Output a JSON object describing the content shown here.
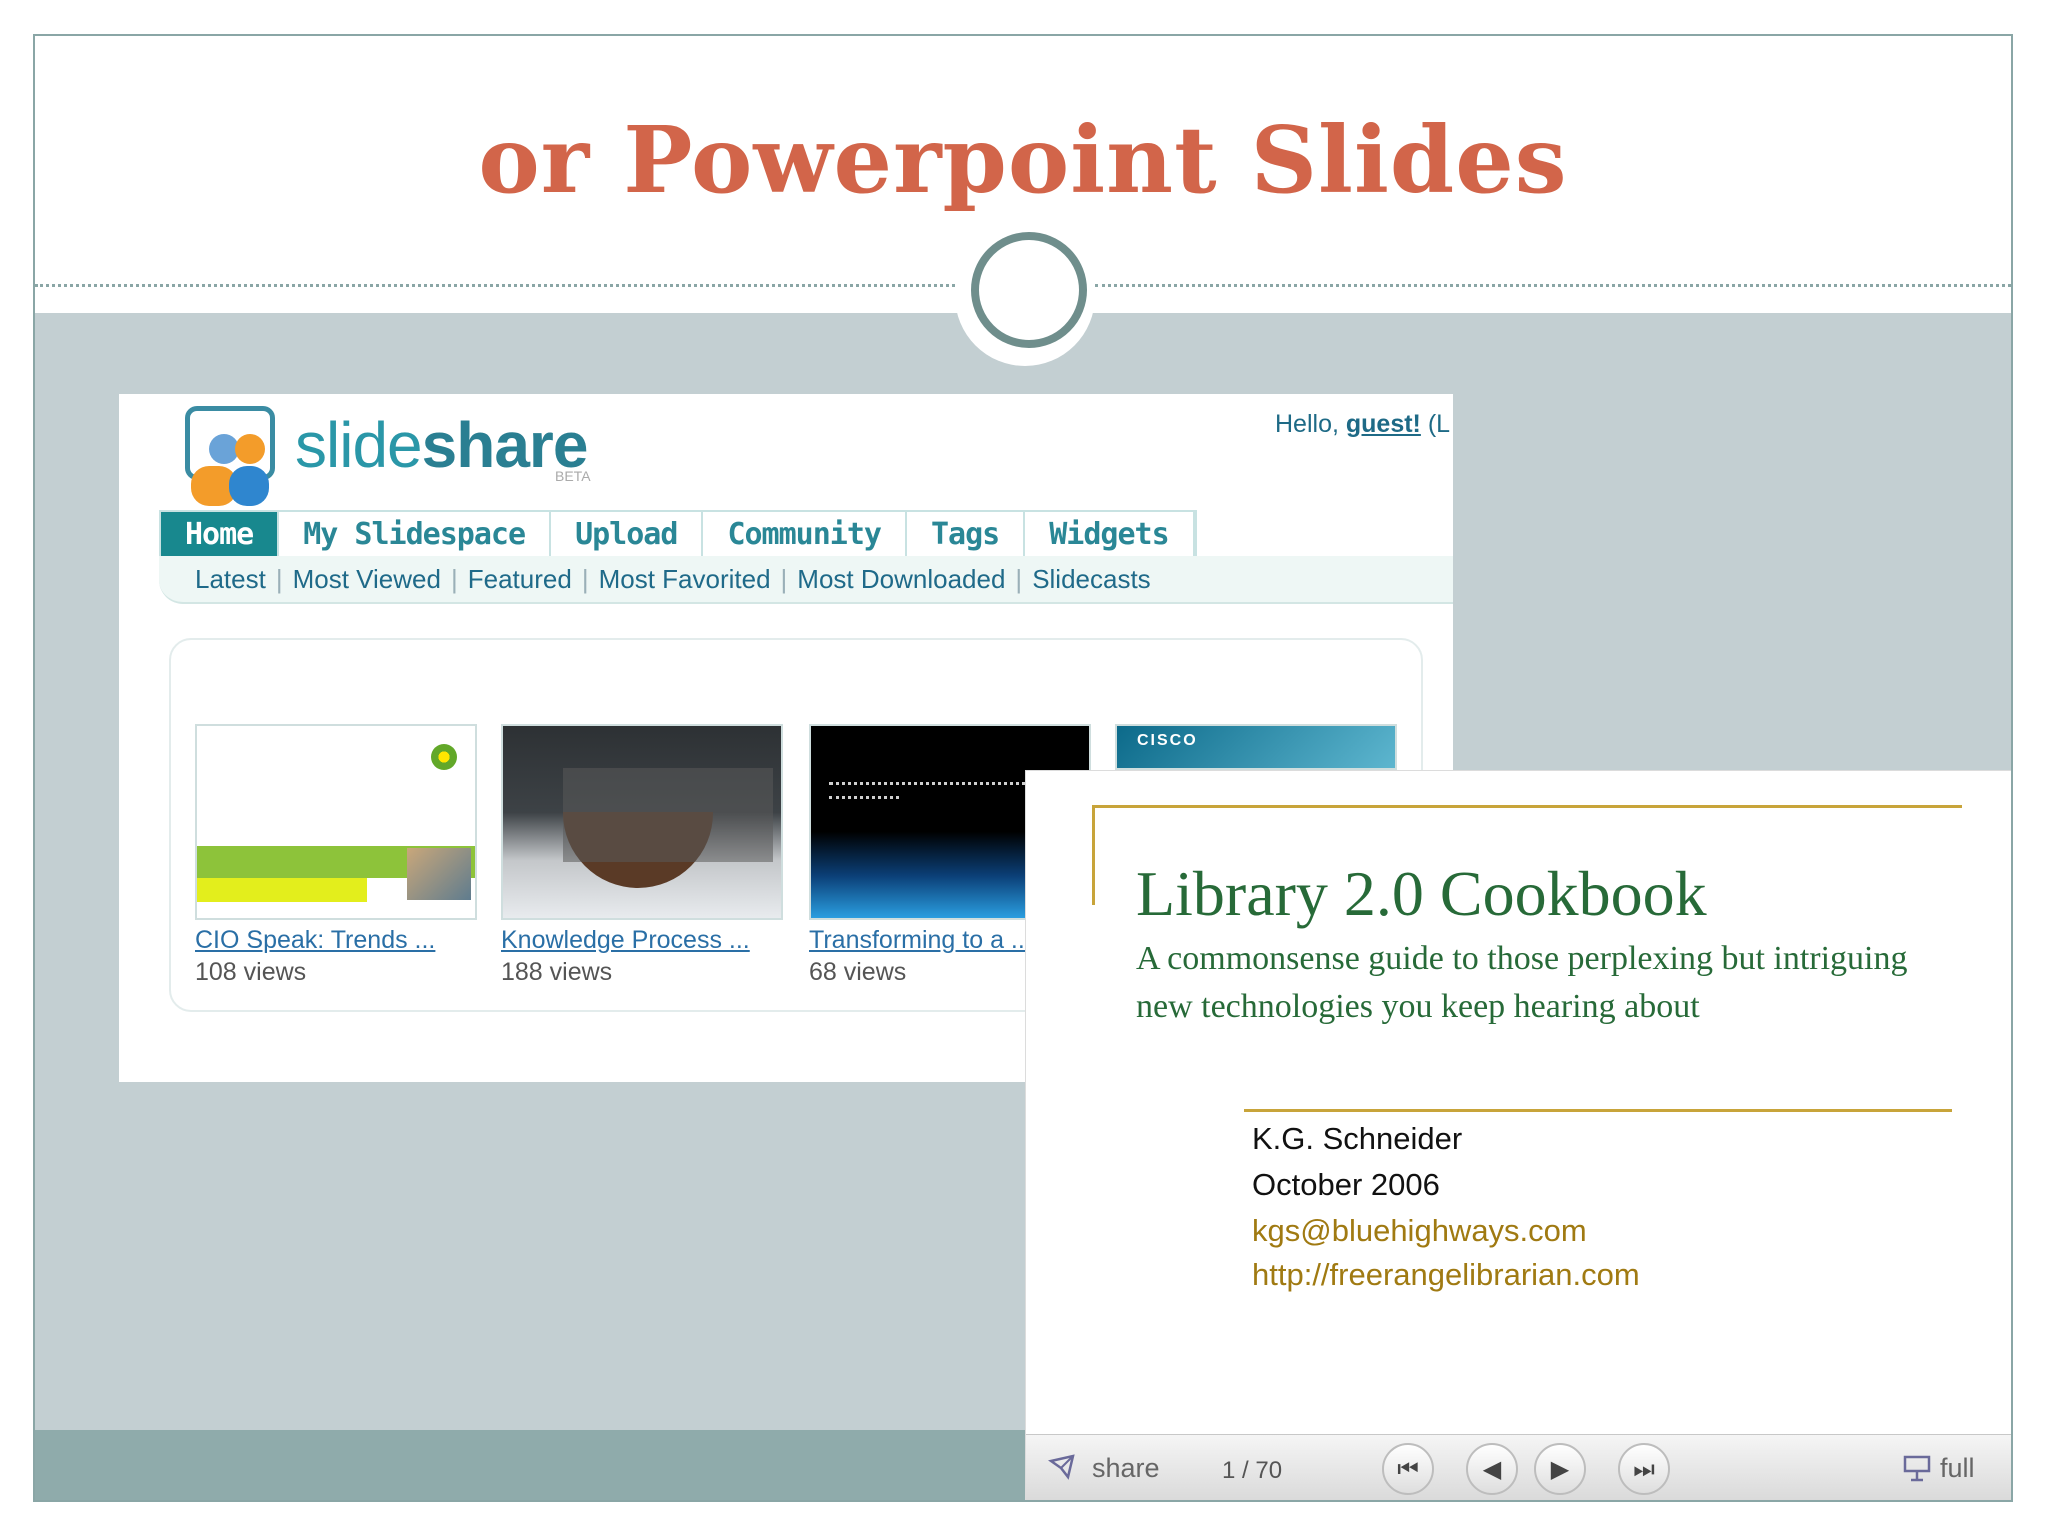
{
  "slide": {
    "title": "or Powerpoint Slides"
  },
  "slideshare": {
    "brand_light": "slide",
    "brand_bold": "share",
    "beta": "BETA",
    "hello_prefix": "Hello, ",
    "hello_user": "guest!",
    "hello_suffix": " (L",
    "tabs": [
      {
        "label": "Home",
        "active": true
      },
      {
        "label": "My Slidespace"
      },
      {
        "label": "Upload"
      },
      {
        "label": "Community"
      },
      {
        "label": "Tags"
      },
      {
        "label": "Widgets"
      }
    ],
    "subnav": [
      "Latest",
      "Most Viewed",
      "Featured",
      "Most Favorited",
      "Most Downloaded",
      "Slidecasts"
    ],
    "items": [
      {
        "title": "CIO Speak: Trends ...",
        "views": "108 views"
      },
      {
        "title": "Knowledge Process ...",
        "views": "188 views"
      },
      {
        "title": "Transforming to a ...",
        "views": "68 views"
      }
    ],
    "cisco_logo": "CISCO"
  },
  "library_slide": {
    "title": "Library 2.0 Cookbook",
    "subtitle": "A commonsense guide to those perplexing but intriguing  new technologies you keep hearing about",
    "author": "K.G. Schneider",
    "date": "October 2006",
    "email": "kgs@bluehighways.com",
    "url": "http://freerangelibrarian.com"
  },
  "player": {
    "share_label": "share",
    "page_indicator": "1 / 70",
    "full_label": "full"
  },
  "colors": {
    "title": "#d2654a",
    "accent_teal": "#18888e",
    "library_green": "#276a38",
    "gold": "#c8a43a"
  }
}
